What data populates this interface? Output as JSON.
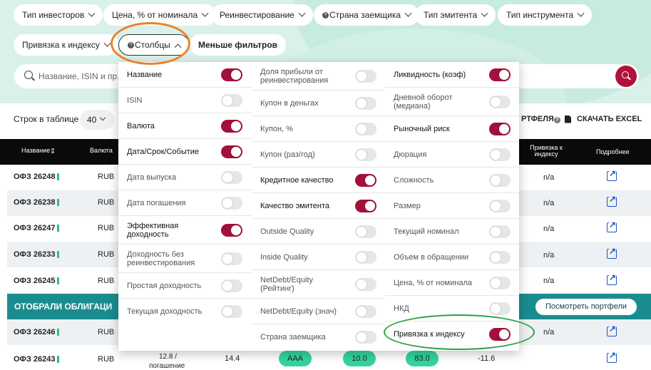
{
  "filters": {
    "investor_type": "Тип инвесторов",
    "price": "Цена, % от номинала",
    "reinvest": "Реинвестирование",
    "borrower_country": "Страна заемщика",
    "issuer_type": "Тип эмитента",
    "instrument_type": "Тип инструмента",
    "index_link": "Привязка к индексу",
    "columns": "Столбцы",
    "fewer_filters": "Меньше фильтров"
  },
  "search": {
    "placeholder": "Название, ISIN и пр."
  },
  "toolbar": {
    "rows_label": "Строк в таблице",
    "rows_value": "40",
    "portfolio_tail": "РТФЕЛЯ",
    "download_excel": "СКАЧАТЬ EXCEL"
  },
  "table": {
    "headers": {
      "name": "Название",
      "currency": "Валюта",
      "index_link": "Привязка к индексу",
      "more": "Подробнее"
    },
    "rows": [
      {
        "name": "ОФЗ 26248",
        "currency": "RUB",
        "index": "n/a"
      },
      {
        "name": "ОФЗ 26238",
        "currency": "RUB",
        "index": "n/a"
      },
      {
        "name": "ОФЗ 26247",
        "currency": "RUB",
        "index": "n/a"
      },
      {
        "name": "ОФЗ 26233",
        "currency": "RUB",
        "index": "n/a"
      },
      {
        "name": "ОФЗ 26245",
        "currency": "RUB",
        "index": "n/a"
      }
    ],
    "selected_label": "ОТОБРАЛИ ОБЛИГАЦИ",
    "view_portfolios": "Посмотреть портфели",
    "rows_after": [
      {
        "name": "ОФЗ 26246",
        "currency": "RUB",
        "index": "n/a"
      },
      {
        "name": "ОФЗ 26243",
        "currency": "RUB",
        "date_line1": "12.8 /",
        "date_line2": "погашение",
        "yield": "14.4",
        "credit": "AAA",
        "liquidity": "10.0",
        "risk": "83.0",
        "value": "-11.6"
      }
    ]
  },
  "columns_panel": {
    "col1": [
      {
        "label": "Название",
        "on": true
      },
      {
        "label": "ISIN",
        "on": false
      },
      {
        "label": "Валюта",
        "on": true
      },
      {
        "label": "Дата/Срок/Событие",
        "on": true
      },
      {
        "label": "Дата выпуска",
        "on": false
      },
      {
        "label": "Дата погашения",
        "on": false
      },
      {
        "label": "Эффективная доходность",
        "on": true
      },
      {
        "label": "Доходность без реинвестирования",
        "on": false
      },
      {
        "label": "Простая доходность",
        "on": false
      },
      {
        "label": "Текущая доходность",
        "on": false
      }
    ],
    "col2": [
      {
        "label": "Доля прибыли от реинвестирования",
        "on": false
      },
      {
        "label": "Купон в деньгах",
        "on": false
      },
      {
        "label": "Купон, %",
        "on": false
      },
      {
        "label": "Купон (раз/год)",
        "on": false
      },
      {
        "label": "Кредитное качество",
        "on": true
      },
      {
        "label": "Качество эмитента",
        "on": true
      },
      {
        "label": "Outside Quality",
        "on": false
      },
      {
        "label": "Inside Quality",
        "on": false
      },
      {
        "label": "NetDebt/Equity (Рейтинг)",
        "on": false
      },
      {
        "label": "NetDebt/Equity (знач)",
        "on": false
      },
      {
        "label": "Страна заемщика",
        "on": false
      }
    ],
    "col3": [
      {
        "label": "Ликвидность (коэф)",
        "on": true
      },
      {
        "label": "Дневной оборот (медиана)",
        "on": false
      },
      {
        "label": "Рыночный риск",
        "on": true
      },
      {
        "label": "Дюрация",
        "on": false
      },
      {
        "label": "Сложность",
        "on": false
      },
      {
        "label": "Размер",
        "on": false
      },
      {
        "label": "Текущий номинал",
        "on": false
      },
      {
        "label": "Объем в обращении",
        "on": false
      },
      {
        "label": "Цена, % от номинала",
        "on": false
      },
      {
        "label": "НКД",
        "on": false
      },
      {
        "label": "Привязка к индексу",
        "on": true
      }
    ]
  },
  "colors": {
    "accent": "#a31039",
    "teal": "#1a8c8f",
    "green_badge": "#34d4a0",
    "header_bg": "#d9f1ea"
  }
}
